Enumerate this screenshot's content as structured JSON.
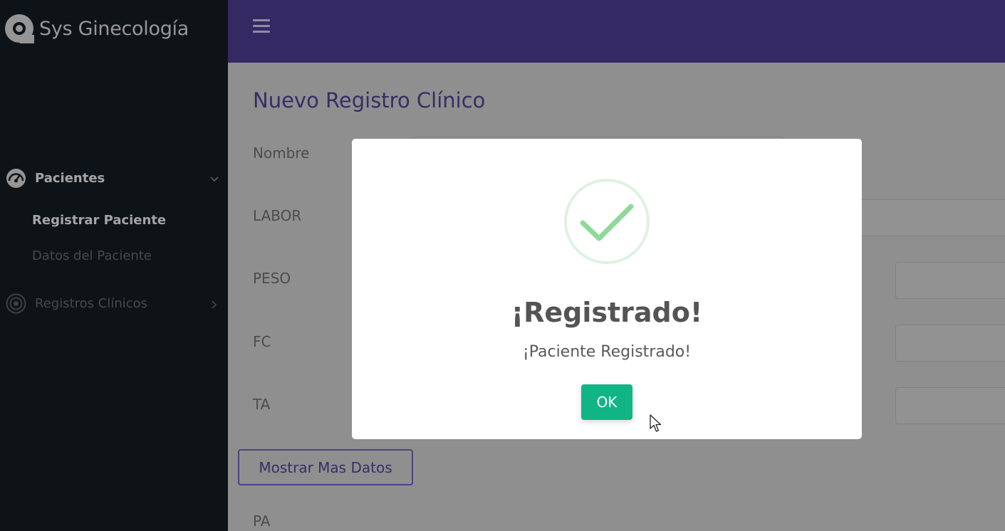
{
  "brand": {
    "title": "Sys Ginecología",
    "logo": "logo-icon"
  },
  "header": {
    "menu_icon": "hamburger-icon",
    "color": "#4a3a8a"
  },
  "sidebar": {
    "sections": [
      {
        "label": "Pacientes",
        "icon": "dashboard-icon",
        "expanded": true,
        "items": [
          {
            "label": "Registrar Paciente",
            "active": true
          },
          {
            "label": "Datos del Paciente",
            "active": false
          }
        ]
      },
      {
        "label": "Registros Clínicos",
        "icon": "target-icon",
        "expanded": false
      }
    ]
  },
  "main": {
    "title": "Nuevo Registro Clínico",
    "fields": [
      "Nombre",
      "LABOR",
      "PESO",
      "FC",
      "TA",
      "PA"
    ],
    "show_more_label": "Mostrar Mas Datos"
  },
  "modal": {
    "icon": "success-check-icon",
    "title": "¡Registrado!",
    "text": "¡Paciente Registrado!",
    "ok_label": "OK",
    "ok_color": "#11b585"
  }
}
